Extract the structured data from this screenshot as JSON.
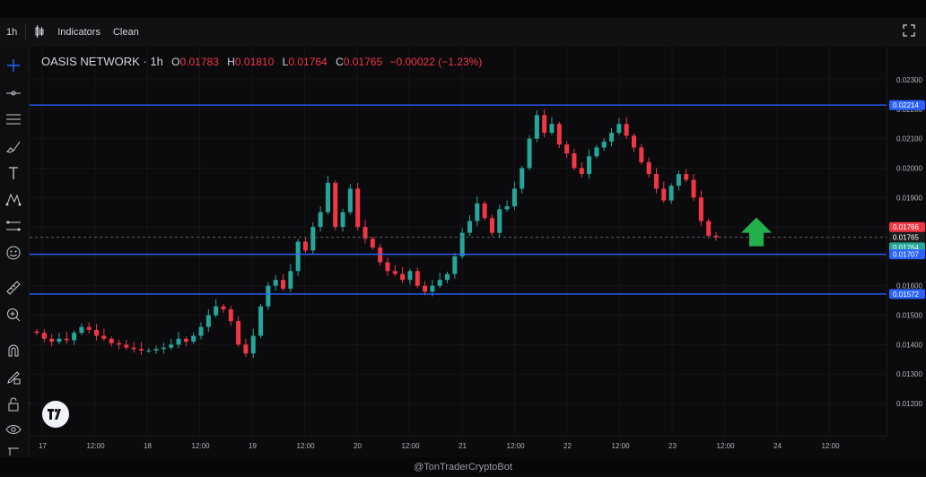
{
  "toolbar": {
    "interval": "1h",
    "indicators_label": "Indicators",
    "clean_label": "Clean"
  },
  "legend": {
    "symbol": "OASIS NETWORK · 1h",
    "open_label": "O",
    "open": "0.01783",
    "high_label": "H",
    "high": "0.01810",
    "low_label": "L",
    "low": "0.01764",
    "close_label": "C",
    "close": "0.01765",
    "change": "−0.00022 (−1.23%)"
  },
  "icons": {
    "left_tools": [
      "crosshair-icon",
      "horizontal-line-icon",
      "parallel-channel-icon",
      "brush-icon",
      "text-icon",
      "pattern-icon",
      "measure-icon",
      "emoji-icon",
      "ruler-icon",
      "zoom-icon",
      "magnet-icon",
      "lock-drawing-icon",
      "lock-icon",
      "eye-icon",
      "trash-icon"
    ]
  },
  "colors": {
    "up": "#26a69a",
    "down": "#f23645",
    "level_line": "#2962ff",
    "arrow": "#22b14c",
    "bg": "#0b0b0d",
    "grid": "#16161a"
  },
  "watermark": "@TonTraderCryptoBot",
  "chart_data": {
    "type": "candlestick",
    "y_ticks": [
      "0.02300",
      "0.02200",
      "0.02100",
      "0.02000",
      "0.01900",
      "0.01800",
      "0.01700",
      "0.01600",
      "0.01500",
      "0.01400",
      "0.01300",
      "0.01200"
    ],
    "y_tick_values": [
      0.023,
      0.022,
      0.021,
      0.02,
      0.019,
      0.018,
      0.017,
      0.016,
      0.015,
      0.014,
      0.013,
      0.012
    ],
    "x_ticks": [
      "17",
      "12:00",
      "18",
      "12:00",
      "19",
      "12:00",
      "20",
      "12:00",
      "21",
      "12:00",
      "22",
      "12:00",
      "23",
      "12:00",
      "24",
      "12:00"
    ],
    "price_labels": [
      {
        "text": "0.02214",
        "value": 0.02214,
        "color": "#2962ff"
      },
      {
        "text": "0.01766",
        "value": 0.01766,
        "color": "#f23645"
      },
      {
        "text": "0.01765",
        "value": 0.01765,
        "color": "#1c1c1f"
      },
      {
        "text": "0.01764",
        "value": 0.01764,
        "color": "#26a69a"
      },
      {
        "text": "0.01707",
        "value": 0.01707,
        "color": "#2962ff"
      },
      {
        "text": "0.01572",
        "value": 0.01572,
        "color": "#2962ff"
      }
    ],
    "levels": [
      0.02214,
      0.01707,
      0.01572
    ],
    "last_price": 0.01765,
    "close_path": [
      0.0144,
      0.0142,
      0.0141,
      0.0142,
      0.01415,
      0.0144,
      0.0146,
      0.0145,
      0.0143,
      0.0142,
      0.01405,
      0.014,
      0.0139,
      0.01385,
      0.0138,
      0.0138,
      0.01385,
      0.0139,
      0.014,
      0.0142,
      0.0141,
      0.0143,
      0.0146,
      0.015,
      0.0153,
      0.0152,
      0.0148,
      0.014,
      0.0137,
      0.0143,
      0.0153,
      0.016,
      0.0162,
      0.0159,
      0.0165,
      0.0175,
      0.0172,
      0.018,
      0.0185,
      0.0195,
      0.018,
      0.0185,
      0.0193,
      0.018,
      0.0176,
      0.0173,
      0.0168,
      0.0165,
      0.0164,
      0.0162,
      0.0165,
      0.016,
      0.0158,
      0.016,
      0.0162,
      0.0164,
      0.017,
      0.0178,
      0.0182,
      0.0188,
      0.0183,
      0.0178,
      0.0186,
      0.0187,
      0.0193,
      0.02,
      0.021,
      0.0218,
      0.0212,
      0.0215,
      0.0208,
      0.0205,
      0.02,
      0.0198,
      0.0204,
      0.0207,
      0.0209,
      0.0212,
      0.0215,
      0.0211,
      0.0207,
      0.0202,
      0.0198,
      0.0193,
      0.0189,
      0.0194,
      0.0198,
      0.0196,
      0.019,
      0.0182,
      0.0177,
      0.01765
    ]
  }
}
